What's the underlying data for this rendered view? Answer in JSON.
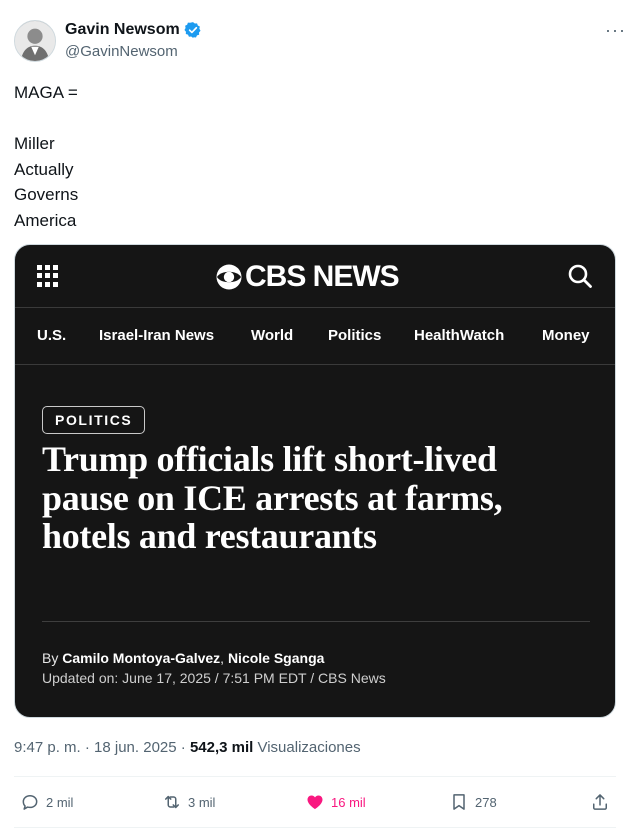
{
  "author": {
    "display_name": "Gavin Newsom",
    "handle": "@GavinNewsom",
    "verified": true,
    "verified_color": "#1d9bf0"
  },
  "tweet": {
    "text": "MAGA =\n\nMiller\nActually\nGoverns\nAmerica"
  },
  "card": {
    "brand": "CBS NEWS",
    "nav": [
      "U.S.",
      "Israel-Iran News",
      "World",
      "Politics",
      "HealthWatch",
      "Money"
    ],
    "section_tag": "POLITICS",
    "headline": "Trump officials lift short-lived pause on ICE arrests at farms, hotels and restaurants",
    "byline_prefix": "By ",
    "authors": "Camilo Montoya-Galvez",
    "authors_sep": ", ",
    "authors_2": "Nicole Sganga",
    "updated": "Updated on: June 17, 2025 / 7:51 PM EDT / CBS News",
    "background": "#151515"
  },
  "meta": {
    "timestamp": "9:47 p. m. · 18 jun. 2025 · ",
    "views_count": "542,3 mil",
    "views_label": " Visualizaciones"
  },
  "actions": {
    "replies": "2 mil",
    "reposts": "3 mil",
    "likes": "16 mil",
    "bookmarks": "278",
    "like_color": "#f91880"
  }
}
